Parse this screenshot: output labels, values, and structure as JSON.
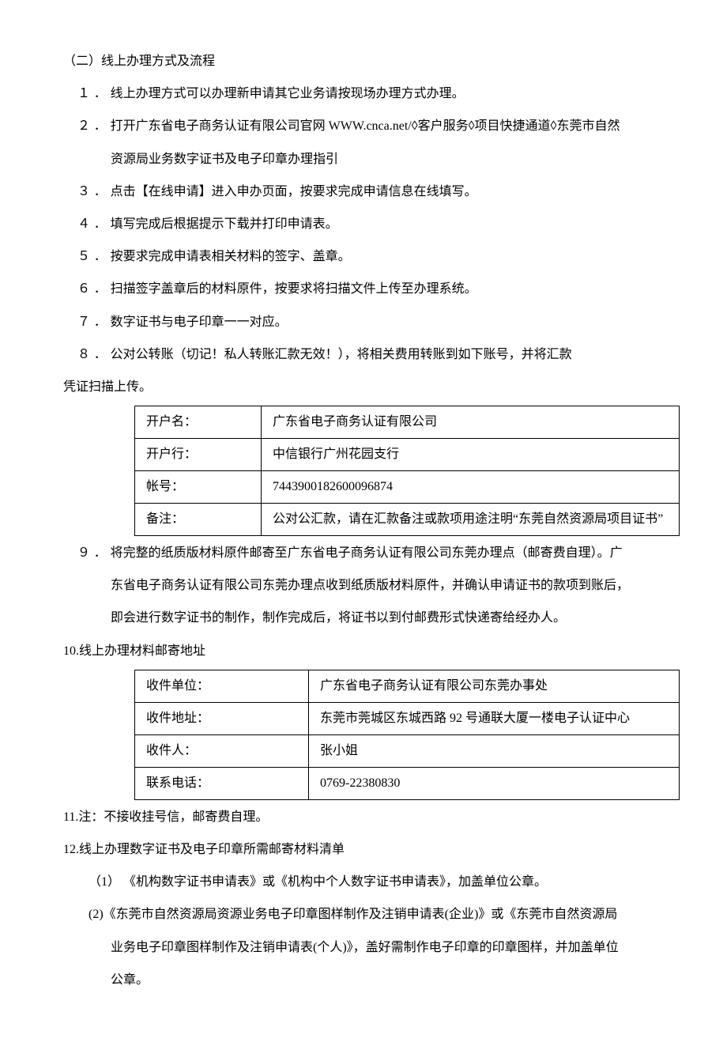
{
  "section_title": "（二）线上办理方式及流程",
  "items": {
    "i1_num": "１．",
    "i1": "线上办理方式可以办理新申请其它业务请按现场办理方式办理。",
    "i2_num": "２．",
    "i2": "打开广东省电子商务认证有限公司官网 WWW.cnca.net/◊客户服务◊项目快捷通道◊东莞市自然",
    "i2c": "资源局业务数字证书及电子印章办理指引",
    "i3_num": "３．",
    "i3": "点击【在线申请】进入申办页面，按要求完成申请信息在线填写。",
    "i4_num": "４．",
    "i4": "填写完成后根据提示下载并打印申请表。",
    "i5_num": "５．",
    "i5": "按要求完成申请表相关材料的签字、盖章。",
    "i6_num": "６．",
    "i6": "扫描签字盖章后的材料原件，按要求将扫描文件上传至办理系统。",
    "i7_num": "７．",
    "i7": "数字证书与电子印章一一对应。",
    "i8_num": "８．",
    "i8": "公对公转账（切记！私人转账汇款无效！），将相关费用转账到如下账号，并将汇款",
    "i8c": "凭证扫描上传。",
    "i9_num": "９．",
    "i9": "将完整的纸质版材料原件邮寄至广东省电子商务认证有限公司东莞办理点（邮寄费自理）。广",
    "i9c1": "东省电子商务认证有限公司东莞办理点收到纸质版材料原件，并确认申请证书的款项到账后，",
    "i9c2": "即会进行数字证书的制作，制作完成后，将证书以到付邮费形式快递寄给经办人。",
    "i10": "10.线上办理材料邮寄地址",
    "i11": "11.注：不接收挂号信，邮寄费自理。",
    "i12": "12.线上办理数字证书及电子印章所需邮寄材料清单",
    "i12_1": "（1） 《机构数字证书申请表》或《机构中个人数字证书申请表》，加盖单位公章。",
    "i12_2a": "(2)《东莞市自然资源局资源业务电子印章图样制作及注销申请表(企业)》或《东莞市自然资源局",
    "i12_2b": "业务电子印章图样制作及注销申请表(个人)》，盖好需制作电子印章的印章图样，并加盖单位",
    "i12_2c": "公章。"
  },
  "table1": {
    "r1_label": "开户名：",
    "r1_val": "广东省电子商务认证有限公司",
    "r2_label": "开户行：",
    "r2_val": "中信银行广州花园支行",
    "r3_label": "帐号：",
    "r3_val": "7443900182600096874",
    "r4_label": "备注：",
    "r4_val": "公对公汇款，请在汇款备注或款项用途注明“东莞自然资源局项目证书”"
  },
  "table2": {
    "r1_label": "收件单位：",
    "r1_val": "广东省电子商务认证有限公司东莞办事处",
    "r2_label": "收件地址：",
    "r2_val": "东莞市莞城区东城西路 92 号通联大厦一楼电子认证中心",
    "r3_label": "收件人：",
    "r3_val": "张小姐",
    "r4_label": "联系电话：",
    "r4_val": "0769-22380830"
  }
}
